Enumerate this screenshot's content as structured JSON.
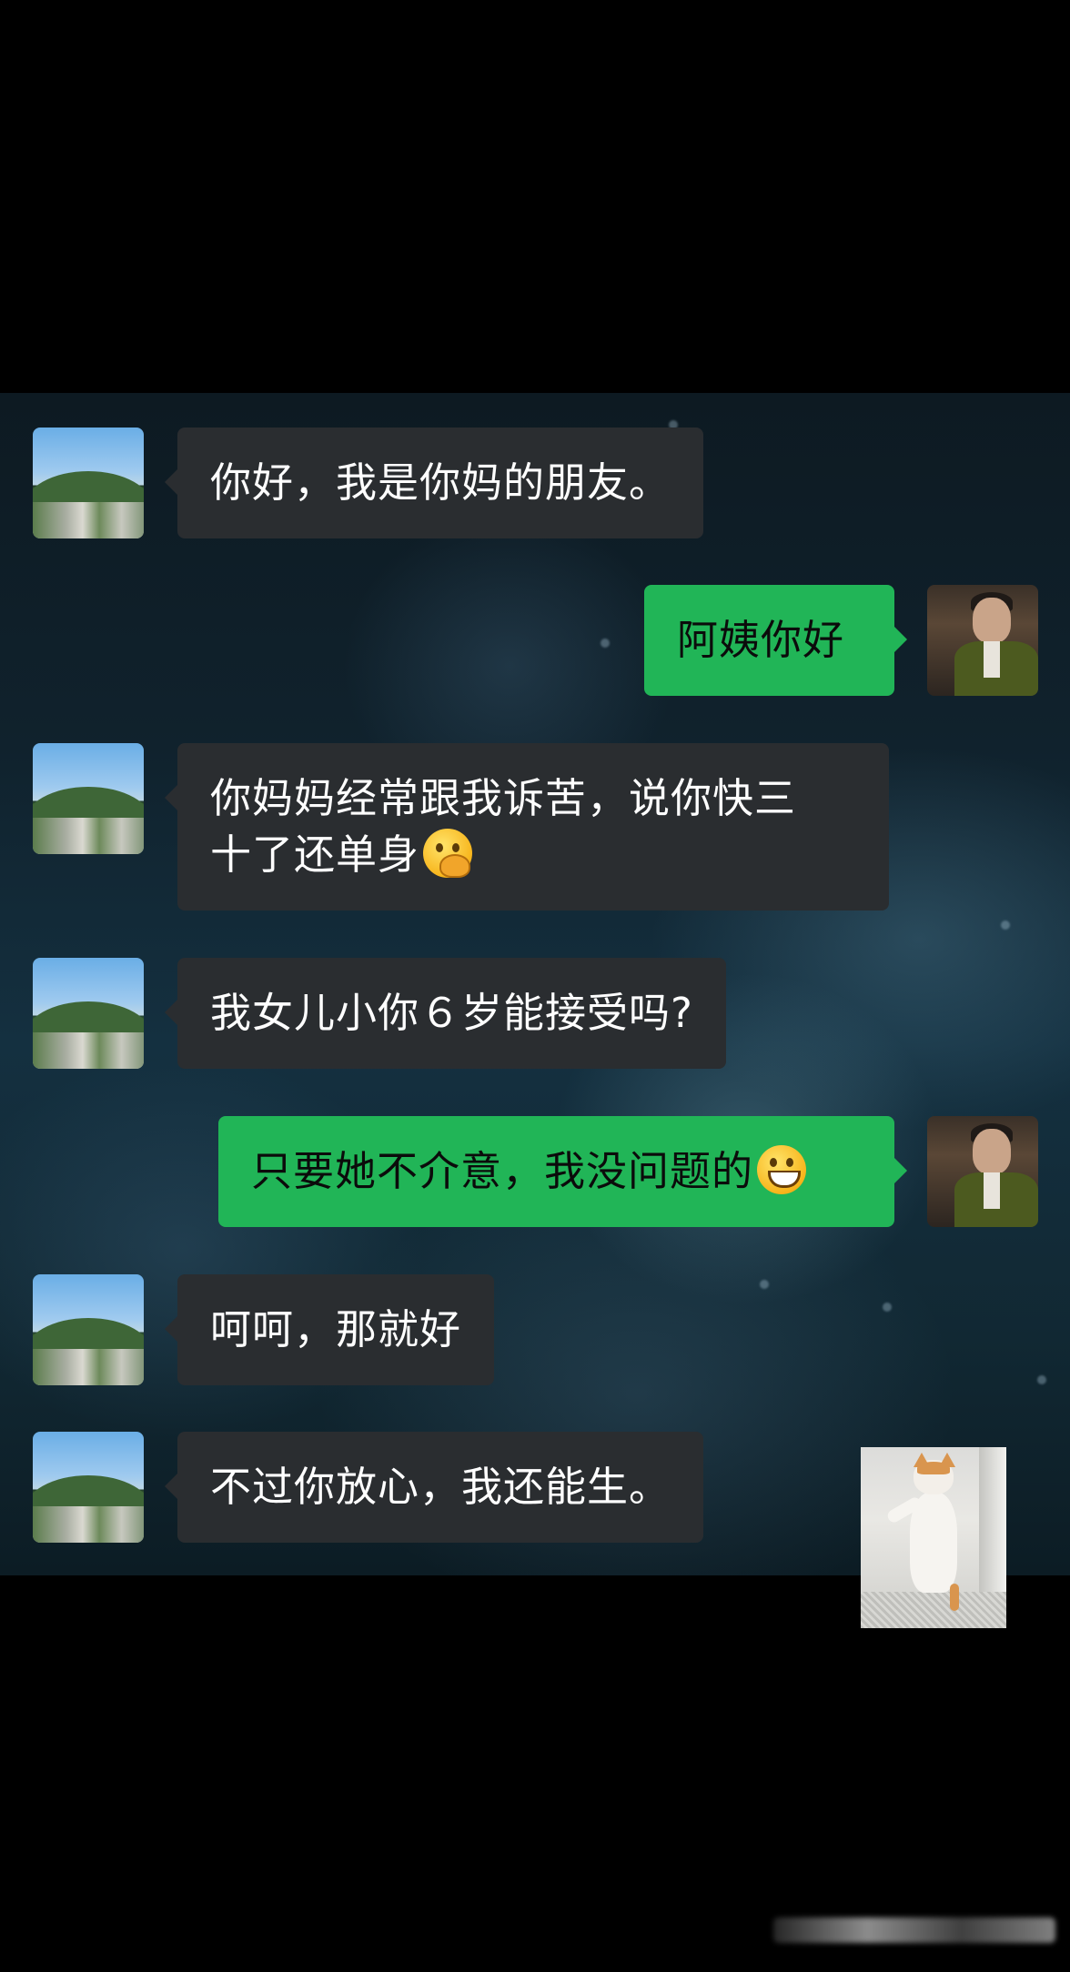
{
  "conversation": {
    "messages": [
      {
        "sender": "other",
        "text": "你好，我是你妈的朋友。"
      },
      {
        "sender": "self",
        "text": "阿姨你好"
      },
      {
        "sender": "other",
        "text_line1": "你妈妈经常跟我诉苦，说你快三",
        "text_line2": "十了还单身",
        "emoji": "face-with-hand-over-mouth"
      },
      {
        "sender": "other",
        "text": "我女儿小你６岁能接受吗?"
      },
      {
        "sender": "self",
        "text": "只要她不介意，我没问题的",
        "emoji": "grinning-face"
      },
      {
        "sender": "other",
        "text": "呵呵，那就好"
      },
      {
        "sender": "other",
        "text": "不过你放心，我还能生。"
      }
    ],
    "sticker": "cat-dancing-sticker"
  },
  "colors": {
    "outgoing_bubble": "#21b557",
    "incoming_bubble": "#2a2d30",
    "background": "#000000"
  }
}
